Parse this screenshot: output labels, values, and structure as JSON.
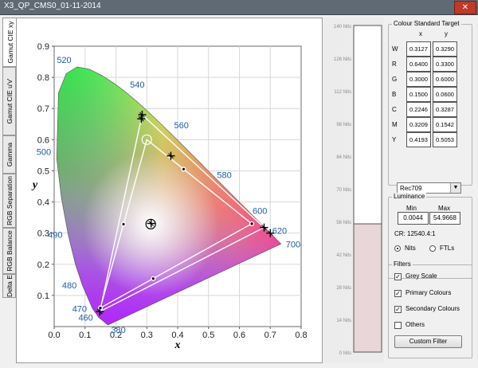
{
  "window": {
    "title": "X3_QP_CMS0_01-11-2014",
    "close_label": "✕"
  },
  "tabs": [
    {
      "label": "Gamut CIE xy",
      "active": true
    },
    {
      "label": "Gamut CIE u'v'",
      "active": false
    },
    {
      "label": "Gamma",
      "active": false
    },
    {
      "label": "RGB Separation",
      "active": false
    },
    {
      "label": "RGB Balance",
      "active": false
    },
    {
      "label": "Delta E",
      "active": false
    }
  ],
  "chart_data": {
    "type": "scatter",
    "title": "",
    "xlabel": "x",
    "ylabel": "y",
    "xlim": [
      0.0,
      0.8
    ],
    "ylim": [
      0.0,
      0.9
    ],
    "x_ticks": [
      "0.0",
      "0.1",
      "0.2",
      "0.3",
      "0.4",
      "0.5",
      "0.6",
      "0.7",
      "0.8"
    ],
    "y_ticks": [
      "0.1",
      "0.2",
      "0.3",
      "0.4",
      "0.5",
      "0.6",
      "0.7",
      "0.8",
      "0.9"
    ],
    "grid": true,
    "wavelength_labels": [
      {
        "text": "380",
        "x": 0.174,
        "y": 0.005
      },
      {
        "text": "460",
        "x": 0.144,
        "y": 0.03
      },
      {
        "text": "470",
        "x": 0.124,
        "y": 0.058
      },
      {
        "text": "480",
        "x": 0.091,
        "y": 0.133
      },
      {
        "text": "490",
        "x": 0.045,
        "y": 0.295
      },
      {
        "text": "500",
        "x": 0.008,
        "y": 0.538
      },
      {
        "text": "520",
        "x": 0.074,
        "y": 0.834
      },
      {
        "text": "540",
        "x": 0.23,
        "y": 0.754
      },
      {
        "text": "560",
        "x": 0.373,
        "y": 0.624
      },
      {
        "text": "580",
        "x": 0.512,
        "y": 0.487
      },
      {
        "text": "600",
        "x": 0.627,
        "y": 0.372
      },
      {
        "text": "620",
        "x": 0.691,
        "y": 0.308
      },
      {
        "text": "700",
        "x": 0.735,
        "y": 0.265
      }
    ],
    "series": [
      {
        "name": "Target",
        "points": [
          {
            "label": "W",
            "x": 0.3127,
            "y": 0.329
          },
          {
            "label": "R",
            "x": 0.64,
            "y": 0.33
          },
          {
            "label": "G",
            "x": 0.3,
            "y": 0.6
          },
          {
            "label": "B",
            "x": 0.15,
            "y": 0.06
          },
          {
            "label": "C",
            "x": 0.2246,
            "y": 0.3287
          },
          {
            "label": "M",
            "x": 0.3209,
            "y": 0.1542
          },
          {
            "label": "Y",
            "x": 0.4193,
            "y": 0.5053
          }
        ]
      },
      {
        "name": "Measured",
        "points": [
          {
            "label": "W",
            "x": 0.314,
            "y": 0.331
          },
          {
            "label": "R",
            "x": 0.68,
            "y": 0.318
          },
          {
            "label": "G",
            "x": 0.285,
            "y": 0.68
          },
          {
            "label": "B",
            "x": 0.148,
            "y": 0.048
          },
          {
            "label": "C",
            "x": 0.282,
            "y": 0.667
          },
          {
            "label": "M",
            "x": 0.7,
            "y": 0.3
          },
          {
            "label": "Y",
            "x": 0.378,
            "y": 0.548
          }
        ]
      }
    ]
  },
  "luminance_strip": {
    "labels": [
      "140 Nits",
      "126 Nits",
      "112 Nits",
      "98 Nits",
      "84 Nits",
      "70 Nits",
      "56 Nits",
      "42 Nits",
      "28 Nits",
      "14 Nits",
      "0 Nits"
    ],
    "max": 140,
    "value": 54.9668
  },
  "colour_standard": {
    "legend": "Colour Standard Target",
    "col_x": "x",
    "col_y": "y",
    "rows": [
      {
        "label": "W",
        "x": "0.3127",
        "y": "0.3290"
      },
      {
        "label": "R",
        "x": "0.6400",
        "y": "0.3300"
      },
      {
        "label": "G",
        "x": "0.3000",
        "y": "0.6000"
      },
      {
        "label": "B",
        "x": "0.1500",
        "y": "0.0600"
      },
      {
        "label": "C",
        "x": "0.2246",
        "y": "0.3287"
      },
      {
        "label": "M",
        "x": "0.3209",
        "y": "0.1542"
      },
      {
        "label": "Y",
        "x": "0.4193",
        "y": "0.5053"
      }
    ],
    "standard": "Rec709",
    "dropdown_arrow": "▼"
  },
  "luminance": {
    "legend": "Luminance",
    "min_label": "Min",
    "max_label": "Max",
    "min_value": "0.0044",
    "max_value": "54.9668",
    "cr": "CR: 12540.4:1",
    "unit_nits": "Nits",
    "unit_ftls": "FTLs",
    "selected_unit": "Nits"
  },
  "filters": {
    "legend": "Filters",
    "items": [
      {
        "label": "Grey Scale",
        "checked": true
      },
      {
        "label": "Primary Colours",
        "checked": true
      },
      {
        "label": "Secondary Colours",
        "checked": true
      },
      {
        "label": "Others",
        "checked": false
      }
    ],
    "check_mark": "✓",
    "button": "Custom Filter"
  },
  "colors": {
    "target_line": "#ffffff",
    "measured_marker": "#000000",
    "lum_fill": "#e8d6d8",
    "gridline": "#d7d7d7",
    "wavelength_text": "#1a5fa8"
  }
}
